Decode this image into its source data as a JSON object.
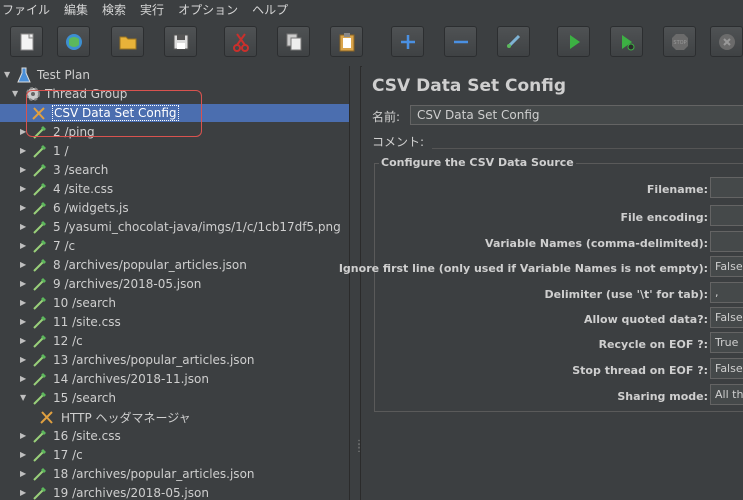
{
  "menu": [
    "ファイル",
    "編集",
    "検索",
    "実行",
    "オプション",
    "ヘルプ"
  ],
  "toolbar": [
    "new-icon",
    "templates-icon",
    "open-icon",
    "save-icon",
    "cut-icon",
    "copy-icon",
    "paste-icon",
    "expand-icon",
    "collapse-icon",
    "toggle-icon",
    "start-icon",
    "start-no-pause-icon",
    "stop-icon",
    "shutdown-icon"
  ],
  "tree": [
    {
      "label": "Test Plan",
      "icon": "test-plan-icon",
      "expanded": true
    },
    {
      "label": "Thread Group",
      "icon": "thread-group-icon",
      "expanded": true
    },
    {
      "label": "CSV Data Set Config",
      "icon": "config-element-icon",
      "selected": true
    },
    {
      "label": "2 /ping",
      "icon": "sampler-icon"
    },
    {
      "label": "1 /",
      "icon": "sampler-icon"
    },
    {
      "label": "3 /search",
      "icon": "sampler-icon"
    },
    {
      "label": "4 /site.css",
      "icon": "sampler-icon"
    },
    {
      "label": "6 /widgets.js",
      "icon": "sampler-icon"
    },
    {
      "label": "5 /yasumi_chocolat-java/imgs/1/c/1cb17df5.png",
      "icon": "sampler-icon"
    },
    {
      "label": "7 /c",
      "icon": "sampler-icon"
    },
    {
      "label": "8 /archives/popular_articles.json",
      "icon": "sampler-icon"
    },
    {
      "label": "9 /archives/2018-05.json",
      "icon": "sampler-icon"
    },
    {
      "label": "10 /search",
      "icon": "sampler-icon"
    },
    {
      "label": "11 /site.css",
      "icon": "sampler-icon"
    },
    {
      "label": "12 /c",
      "icon": "sampler-icon"
    },
    {
      "label": "13 /archives/popular_articles.json",
      "icon": "sampler-icon"
    },
    {
      "label": "14 /archives/2018-11.json",
      "icon": "sampler-icon"
    },
    {
      "label": "15 /search",
      "icon": "sampler-icon",
      "expanded": true
    },
    {
      "label": "HTTP ヘッダマネージャ",
      "icon": "config-element-icon"
    },
    {
      "label": "16 /site.css",
      "icon": "sampler-icon"
    },
    {
      "label": "17 /c",
      "icon": "sampler-icon"
    },
    {
      "label": "18 /archives/popular_articles.json",
      "icon": "sampler-icon"
    },
    {
      "label": "19 /archives/2018-05.json",
      "icon": "sampler-icon"
    }
  ],
  "panel": {
    "title": "CSV Data Set Config",
    "name_label": "名前:",
    "name_value": "CSV Data Set Config",
    "comment_label": "コメント:",
    "group_title": "Configure the CSV Data Source",
    "fields": [
      {
        "label": "Filename:",
        "value": ""
      },
      {
        "label": "File encoding:",
        "value": ""
      },
      {
        "label": "Variable Names (comma-delimited):",
        "value": ""
      },
      {
        "label": "Ignore first line (only used if Variable Names is not empty):",
        "value": "False"
      },
      {
        "label": "Delimiter (use '\\t' for tab):",
        "value": ","
      },
      {
        "label": "Allow quoted data?:",
        "value": "False"
      },
      {
        "label": "Recycle on EOF ?:",
        "value": "True"
      },
      {
        "label": "Stop thread on EOF ?:",
        "value": "False"
      },
      {
        "label": "Sharing mode:",
        "value": "All th"
      }
    ]
  },
  "colors": {
    "selection": "#4b6eaf",
    "background": "#3c3f41",
    "highlight": "#d9534f"
  }
}
